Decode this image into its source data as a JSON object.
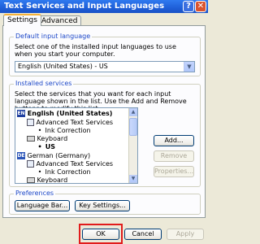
{
  "window": {
    "title": "Text Services and Input Languages",
    "help_glyph": "?",
    "close_glyph": "✕"
  },
  "tabs": [
    {
      "label": "Settings"
    },
    {
      "label": "Advanced"
    }
  ],
  "default_language": {
    "legend": "Default input language",
    "description": "Select one of the installed input languages to use when you start your computer.",
    "selected": "English (United States) - US",
    "dropdown_glyph": "▼"
  },
  "installed_services": {
    "legend": "Installed services",
    "description": "Select the services that you want for each input language shown in the list. Use the Add and Remove buttons to modify this list.",
    "tree": [
      {
        "badge": "EN",
        "text": "English (United States)"
      },
      {
        "text": "Advanced Text Services"
      },
      {
        "text": "Ink Correction"
      },
      {
        "text": "Keyboard"
      },
      {
        "text": "US"
      },
      {
        "badge": "DE",
        "text": "German (Germany)"
      },
      {
        "text": "Advanced Text Services"
      },
      {
        "text": "Ink Correction"
      },
      {
        "text": "Keyboard"
      }
    ],
    "scroll_up": "▲",
    "scroll_down": "▼",
    "buttons": {
      "add": "Add...",
      "remove": "Remove",
      "properties": "Properties..."
    }
  },
  "preferences": {
    "legend": "Preferences",
    "language_bar": "Language Bar...",
    "key_settings": "Key Settings..."
  },
  "dialog_buttons": {
    "ok": "OK",
    "cancel": "Cancel",
    "apply": "Apply"
  },
  "colors": {
    "highlight": "#e11c1c",
    "legend_text": "#1d48c8",
    "titlebar": "#1f5fd8"
  }
}
